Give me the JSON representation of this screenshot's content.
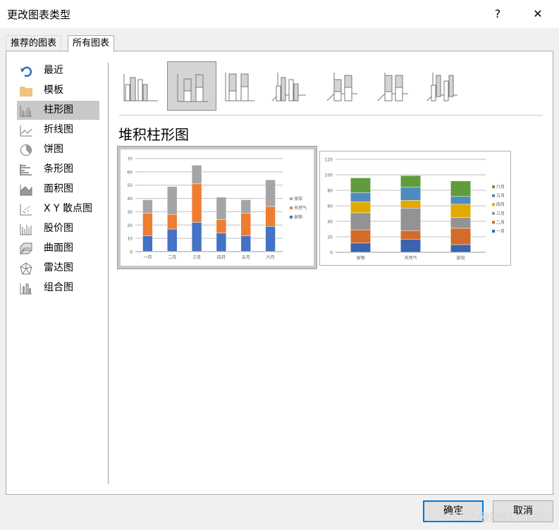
{
  "dialog": {
    "title": "更改图表类型",
    "help": "?",
    "close": "✕"
  },
  "tabs": [
    {
      "label": "推荐的图表"
    },
    {
      "label": "所有图表"
    }
  ],
  "sidebar": {
    "items": [
      {
        "label": "最近",
        "icon": "recent-icon"
      },
      {
        "label": "模板",
        "icon": "folder-icon"
      },
      {
        "label": "柱形图",
        "icon": "column-chart-icon"
      },
      {
        "label": "折线图",
        "icon": "line-chart-icon"
      },
      {
        "label": "饼图",
        "icon": "pie-chart-icon"
      },
      {
        "label": "条形图",
        "icon": "bar-chart-icon"
      },
      {
        "label": "面积图",
        "icon": "area-chart-icon"
      },
      {
        "label": "X Y 散点图",
        "icon": "scatter-chart-icon"
      },
      {
        "label": "股价图",
        "icon": "stock-chart-icon"
      },
      {
        "label": "曲面图",
        "icon": "surface-chart-icon"
      },
      {
        "label": "雷达图",
        "icon": "radar-chart-icon"
      },
      {
        "label": "组合图",
        "icon": "combo-chart-icon"
      }
    ],
    "selected": "柱形图"
  },
  "subtype_heading": "堆积柱形图",
  "buttons": {
    "ok": "确定",
    "cancel": "取消"
  },
  "watermark": "CSDN @juechen333",
  "chart_data": [
    {
      "type": "bar",
      "stacked": true,
      "categories": [
        "一月",
        "二月",
        "三月",
        "四月",
        "五月",
        "六月"
      ],
      "ylim": [
        0,
        70
      ],
      "yticks": [
        0,
        10,
        20,
        30,
        40,
        50,
        60,
        70
      ],
      "legend": "right",
      "series": [
        {
          "name": "食物",
          "color": "#4472c4",
          "values": [
            12,
            17,
            22,
            14,
            12,
            19
          ]
        },
        {
          "name": "天然气",
          "color": "#ed7d31",
          "values": [
            17,
            11,
            29,
            10,
            17,
            15
          ]
        },
        {
          "name": "旅馆",
          "color": "#a5a5a5",
          "values": [
            10,
            21,
            14,
            17,
            10,
            20
          ]
        }
      ]
    },
    {
      "type": "bar",
      "stacked": true,
      "categories": [
        "食物",
        "天然气",
        "旅馆"
      ],
      "ylim": [
        0,
        120
      ],
      "yticks": [
        0,
        20,
        40,
        60,
        80,
        100,
        120
      ],
      "legend": "right",
      "series": [
        {
          "name": "一月",
          "color": "#3c63ad",
          "values": [
            12,
            17,
            10
          ]
        },
        {
          "name": "二月",
          "color": "#d36b2a",
          "values": [
            17,
            11,
            21
          ]
        },
        {
          "name": "三月",
          "color": "#939393",
          "values": [
            22,
            29,
            14
          ]
        },
        {
          "name": "四月",
          "color": "#e2a900",
          "values": [
            14,
            10,
            17
          ]
        },
        {
          "name": "五月",
          "color": "#4f8bc2",
          "values": [
            12,
            17,
            10
          ]
        },
        {
          "name": "六月",
          "color": "#609b3d",
          "values": [
            19,
            15,
            20
          ]
        }
      ]
    }
  ]
}
